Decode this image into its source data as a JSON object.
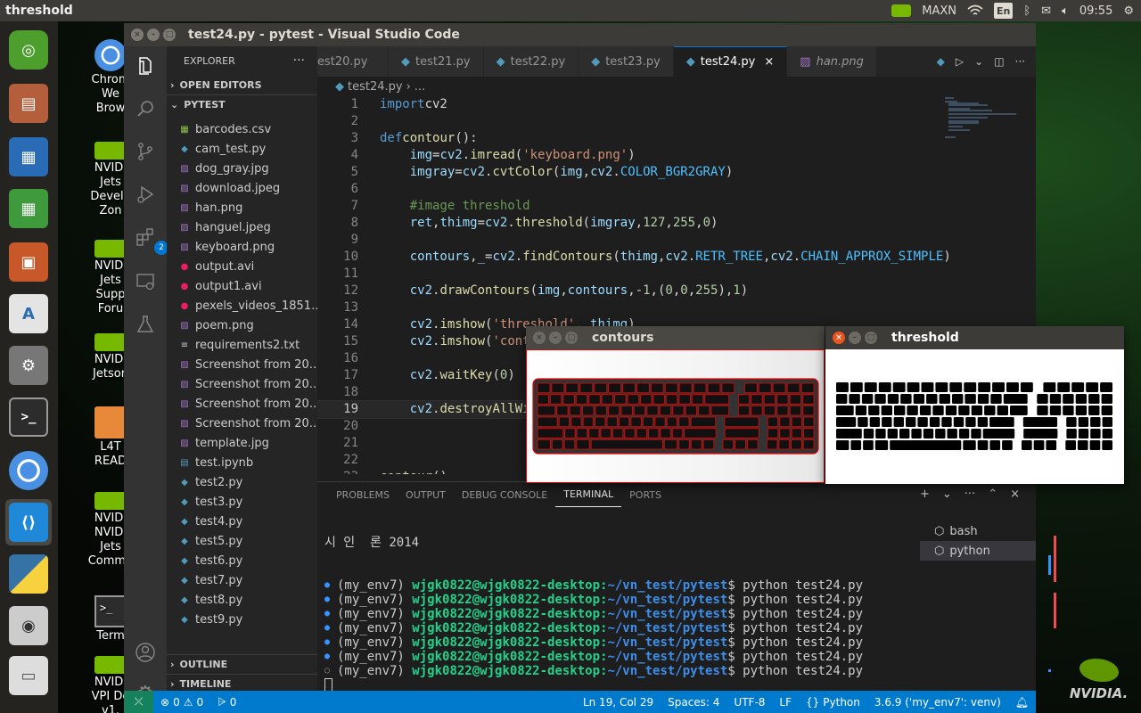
{
  "top_panel": {
    "window_title": "threshold",
    "power_mode": "MAXN",
    "keyboard_layout": "En",
    "clock": "09:55"
  },
  "desktop_icons": [
    {
      "label": "Chrom\nWe\nBrow"
    },
    {
      "label": "NVIDI\nJets\nDevelo\nZon"
    },
    {
      "label": "NVIDI\nJets\nSupp\nForu"
    },
    {
      "label": "NVIDI\nJetson"
    },
    {
      "label": "L4T\nREAD"
    },
    {
      "label": "NVIDI\nNVIDI\nJets\nCommu"
    },
    {
      "label": "Term"
    },
    {
      "label": "NVIDI\nVPI De\nv1."
    }
  ],
  "nvidia_watermark": "NVIDIA.",
  "vscode": {
    "title": "test24.py - pytest - Visual Studio Code",
    "explorer_label": "EXPLORER",
    "open_editors_label": "OPEN EDITORS",
    "project_label": "PYTEST",
    "outline_label": "OUTLINE",
    "timeline_label": "TIMELINE",
    "extensions_badge": "2",
    "files": [
      {
        "name": "barcodes.csv",
        "icon": "csv-icon",
        "color": "#8bc34a"
      },
      {
        "name": "cam_test.py",
        "icon": "python-file-icon",
        "color": "#519aba"
      },
      {
        "name": "dog_gray.jpg",
        "icon": "image-file-icon",
        "color": "#a074c4"
      },
      {
        "name": "download.jpeg",
        "icon": "image-file-icon",
        "color": "#a074c4"
      },
      {
        "name": "han.png",
        "icon": "image-file-icon",
        "color": "#a074c4"
      },
      {
        "name": "hanguel.jpeg",
        "icon": "image-file-icon",
        "color": "#a074c4"
      },
      {
        "name": "keyboard.png",
        "icon": "image-file-icon",
        "color": "#a074c4"
      },
      {
        "name": "output.avi",
        "icon": "video-file-icon",
        "color": "#e91e63"
      },
      {
        "name": "output1.avi",
        "icon": "video-file-icon",
        "color": "#e91e63"
      },
      {
        "name": "pexels_videos_1851...",
        "icon": "video-file-icon",
        "color": "#e91e63"
      },
      {
        "name": "poem.png",
        "icon": "image-file-icon",
        "color": "#a074c4"
      },
      {
        "name": "requirements2.txt",
        "icon": "text-file-icon",
        "color": "#cccccc"
      },
      {
        "name": "Screenshot from 20...",
        "icon": "image-file-icon",
        "color": "#a074c4"
      },
      {
        "name": "Screenshot from 20...",
        "icon": "image-file-icon",
        "color": "#a074c4"
      },
      {
        "name": "Screenshot from 20...",
        "icon": "image-file-icon",
        "color": "#a074c4"
      },
      {
        "name": "Screenshot from 20...",
        "icon": "image-file-icon",
        "color": "#a074c4"
      },
      {
        "name": "template.jpg",
        "icon": "image-file-icon",
        "color": "#a074c4"
      },
      {
        "name": "test.ipynb",
        "icon": "notebook-file-icon",
        "color": "#519aba"
      },
      {
        "name": "test2.py",
        "icon": "python-file-icon",
        "color": "#519aba"
      },
      {
        "name": "test3.py",
        "icon": "python-file-icon",
        "color": "#519aba"
      },
      {
        "name": "test4.py",
        "icon": "python-file-icon",
        "color": "#519aba"
      },
      {
        "name": "test5.py",
        "icon": "python-file-icon",
        "color": "#519aba"
      },
      {
        "name": "test6.py",
        "icon": "python-file-icon",
        "color": "#519aba"
      },
      {
        "name": "test7.py",
        "icon": "python-file-icon",
        "color": "#519aba"
      },
      {
        "name": "test8.py",
        "icon": "python-file-icon",
        "color": "#519aba"
      },
      {
        "name": "test9.py",
        "icon": "python-file-icon",
        "color": "#519aba"
      }
    ],
    "tabs": [
      {
        "label": "est20.py",
        "active": false
      },
      {
        "label": "test21.py",
        "active": false
      },
      {
        "label": "test22.py",
        "active": false
      },
      {
        "label": "test23.py",
        "active": false
      },
      {
        "label": "test24.py",
        "active": true
      },
      {
        "label": "han.png",
        "active": false
      }
    ],
    "breadcrumb": {
      "file": "test24.py",
      "more": "..."
    },
    "code_lines": [
      {
        "n": "1",
        "tokens": [
          [
            "kw",
            "import"
          ],
          [
            "",
            "cv2"
          ]
        ]
      },
      {
        "n": "2",
        "tokens": []
      },
      {
        "n": "3",
        "tokens": [
          [
            "kw",
            "def"
          ],
          [
            "fn",
            "contour"
          ],
          [
            "",
            "():"
          ]
        ]
      },
      {
        "n": "4",
        "tokens": [
          [
            "",
            "    "
          ],
          [
            "var",
            "img"
          ],
          [
            "",
            "="
          ],
          [
            "var",
            "cv2"
          ],
          [
            "",
            "."
          ],
          [
            "fn",
            "imread"
          ],
          [
            "",
            "("
          ],
          [
            "str",
            "'keyboard.png'"
          ],
          [
            "",
            ")"
          ]
        ]
      },
      {
        "n": "5",
        "tokens": [
          [
            "",
            "    "
          ],
          [
            "var",
            "imgray"
          ],
          [
            "",
            "="
          ],
          [
            "var",
            "cv2"
          ],
          [
            "",
            "."
          ],
          [
            "fn",
            "cvtColor"
          ],
          [
            "",
            "("
          ],
          [
            "var",
            "img"
          ],
          [
            "",
            ","
          ],
          [
            "var",
            "cv2"
          ],
          [
            "",
            "."
          ],
          [
            "cst",
            "COLOR_BGR2GRAY"
          ],
          [
            "",
            ")"
          ]
        ]
      },
      {
        "n": "6",
        "tokens": []
      },
      {
        "n": "7",
        "tokens": [
          [
            "",
            "    "
          ],
          [
            "cm",
            "#image threshold"
          ]
        ]
      },
      {
        "n": "8",
        "tokens": [
          [
            "",
            "    "
          ],
          [
            "var",
            "ret"
          ],
          [
            "",
            ","
          ],
          [
            "var",
            "thimg"
          ],
          [
            "",
            "="
          ],
          [
            "var",
            "cv2"
          ],
          [
            "",
            "."
          ],
          [
            "fn",
            "threshold"
          ],
          [
            "",
            "("
          ],
          [
            "var",
            "imgray"
          ],
          [
            "",
            ","
          ],
          [
            "num",
            "127"
          ],
          [
            "",
            ","
          ],
          [
            "num",
            "255"
          ],
          [
            "",
            ","
          ],
          [
            "num",
            "0"
          ],
          [
            "",
            ")"
          ]
        ]
      },
      {
        "n": "9",
        "tokens": []
      },
      {
        "n": "10",
        "tokens": [
          [
            "",
            "    "
          ],
          [
            "var",
            "contours"
          ],
          [
            "",
            ","
          ],
          [
            "var",
            "_"
          ],
          [
            "",
            "="
          ],
          [
            "var",
            "cv2"
          ],
          [
            "",
            "."
          ],
          [
            "fn",
            "findContours"
          ],
          [
            "",
            "("
          ],
          [
            "var",
            "thimg"
          ],
          [
            "",
            ","
          ],
          [
            "var",
            "cv2"
          ],
          [
            "",
            "."
          ],
          [
            "cst",
            "RETR_TREE"
          ],
          [
            "",
            ","
          ],
          [
            "var",
            "cv2"
          ],
          [
            "",
            "."
          ],
          [
            "cst",
            "CHAIN_APPROX_SIMPLE"
          ],
          [
            "",
            ")"
          ]
        ]
      },
      {
        "n": "11",
        "tokens": []
      },
      {
        "n": "12",
        "tokens": [
          [
            "",
            "    "
          ],
          [
            "var",
            "cv2"
          ],
          [
            "",
            "."
          ],
          [
            "fn",
            "drawContours"
          ],
          [
            "",
            "("
          ],
          [
            "var",
            "img"
          ],
          [
            "",
            ","
          ],
          [
            "var",
            "contours"
          ],
          [
            "",
            ","
          ],
          [
            "",
            "-"
          ],
          [
            "num",
            "1"
          ],
          [
            "",
            ",("
          ],
          [
            "num",
            "0"
          ],
          [
            "",
            ","
          ],
          [
            "num",
            "0"
          ],
          [
            "",
            ","
          ],
          [
            "num",
            "255"
          ],
          [
            "",
            "),"
          ],
          [
            "num",
            "1"
          ],
          [
            "",
            ")"
          ]
        ]
      },
      {
        "n": "13",
        "tokens": []
      },
      {
        "n": "14",
        "tokens": [
          [
            "",
            "    "
          ],
          [
            "var",
            "cv2"
          ],
          [
            "",
            "."
          ],
          [
            "fn",
            "imshow"
          ],
          [
            "",
            "("
          ],
          [
            "str",
            "'threshold'"
          ],
          [
            "",
            ", "
          ],
          [
            "var",
            "thimg"
          ],
          [
            "",
            ")"
          ]
        ]
      },
      {
        "n": "15",
        "tokens": [
          [
            "",
            "    "
          ],
          [
            "var",
            "cv2"
          ],
          [
            "",
            "."
          ],
          [
            "fn",
            "imshow"
          ],
          [
            "",
            "("
          ],
          [
            "str",
            "'cont"
          ]
        ]
      },
      {
        "n": "16",
        "tokens": []
      },
      {
        "n": "17",
        "tokens": [
          [
            "",
            "    "
          ],
          [
            "var",
            "cv2"
          ],
          [
            "",
            "."
          ],
          [
            "fn",
            "waitKey"
          ],
          [
            "",
            "("
          ],
          [
            "num",
            "0"
          ],
          [
            "",
            ")"
          ]
        ]
      },
      {
        "n": "18",
        "tokens": []
      },
      {
        "n": "19",
        "tokens": [
          [
            "",
            "    "
          ],
          [
            "var",
            "cv2"
          ],
          [
            "",
            "."
          ],
          [
            "fn",
            "destroyAllWi"
          ]
        ]
      },
      {
        "n": "20",
        "tokens": []
      },
      {
        "n": "21",
        "tokens": []
      },
      {
        "n": "22",
        "tokens": []
      },
      {
        "n": "23",
        "tokens": [
          [
            "fn",
            "contour"
          ],
          [
            "",
            "()"
          ]
        ]
      }
    ],
    "current_line": "19",
    "panel_tabs": [
      {
        "label": "PROBLEMS",
        "active": false
      },
      {
        "label": "OUTPUT",
        "active": false
      },
      {
        "label": "DEBUG CONSOLE",
        "active": false
      },
      {
        "label": "TERMINAL",
        "active": true
      },
      {
        "label": "PORTS",
        "active": false
      }
    ],
    "terminal": {
      "heading": "시 인  론 2014",
      "lines": [
        {
          "env": "(my_env7) ",
          "user": "wjgk0822@wjgk0822-desktop",
          "path": "~/vn_test/pytest",
          "cmd": "$ python test24.py",
          "dot": "filled"
        },
        {
          "env": "(my_env7) ",
          "user": "wjgk0822@wjgk0822-desktop",
          "path": "~/vn_test/pytest",
          "cmd": "$ python test24.py",
          "dot": "filled"
        },
        {
          "env": "(my_env7) ",
          "user": "wjgk0822@wjgk0822-desktop",
          "path": "~/vn_test/pytest",
          "cmd": "$ python test24.py",
          "dot": "filled"
        },
        {
          "env": "(my_env7) ",
          "user": "wjgk0822@wjgk0822-desktop",
          "path": "~/vn_test/pytest",
          "cmd": "$ python test24.py",
          "dot": "filled"
        },
        {
          "env": "(my_env7) ",
          "user": "wjgk0822@wjgk0822-desktop",
          "path": "~/vn_test/pytest",
          "cmd": "$ python test24.py",
          "dot": "filled"
        },
        {
          "env": "(my_env7) ",
          "user": "wjgk0822@wjgk0822-desktop",
          "path": "~/vn_test/pytest",
          "cmd": "$ python test24.py",
          "dot": "filled"
        },
        {
          "env": "(my_env7) ",
          "user": "wjgk0822@wjgk0822-desktop",
          "path": "~/vn_test/pytest",
          "cmd": "$ python test24.py",
          "dot": "hollow"
        }
      ],
      "instances": [
        {
          "label": "bash",
          "active": false
        },
        {
          "label": "python",
          "active": true
        }
      ]
    },
    "status": {
      "errors": "0",
      "warnings": "0",
      "ports": "0",
      "cursor": "Ln 19, Col 29",
      "spaces": "Spaces: 4",
      "encoding": "UTF-8",
      "eol": "LF",
      "language": "Python",
      "interpreter": "3.6.9 ('my_env7': venv)"
    }
  },
  "cv_windows": {
    "contours_title": "contours",
    "threshold_title": "threshold"
  },
  "colors": {
    "accent": "#007acc",
    "ubuntu_panel": "#3c3b37",
    "ubuntu_orange": "#e95420"
  }
}
